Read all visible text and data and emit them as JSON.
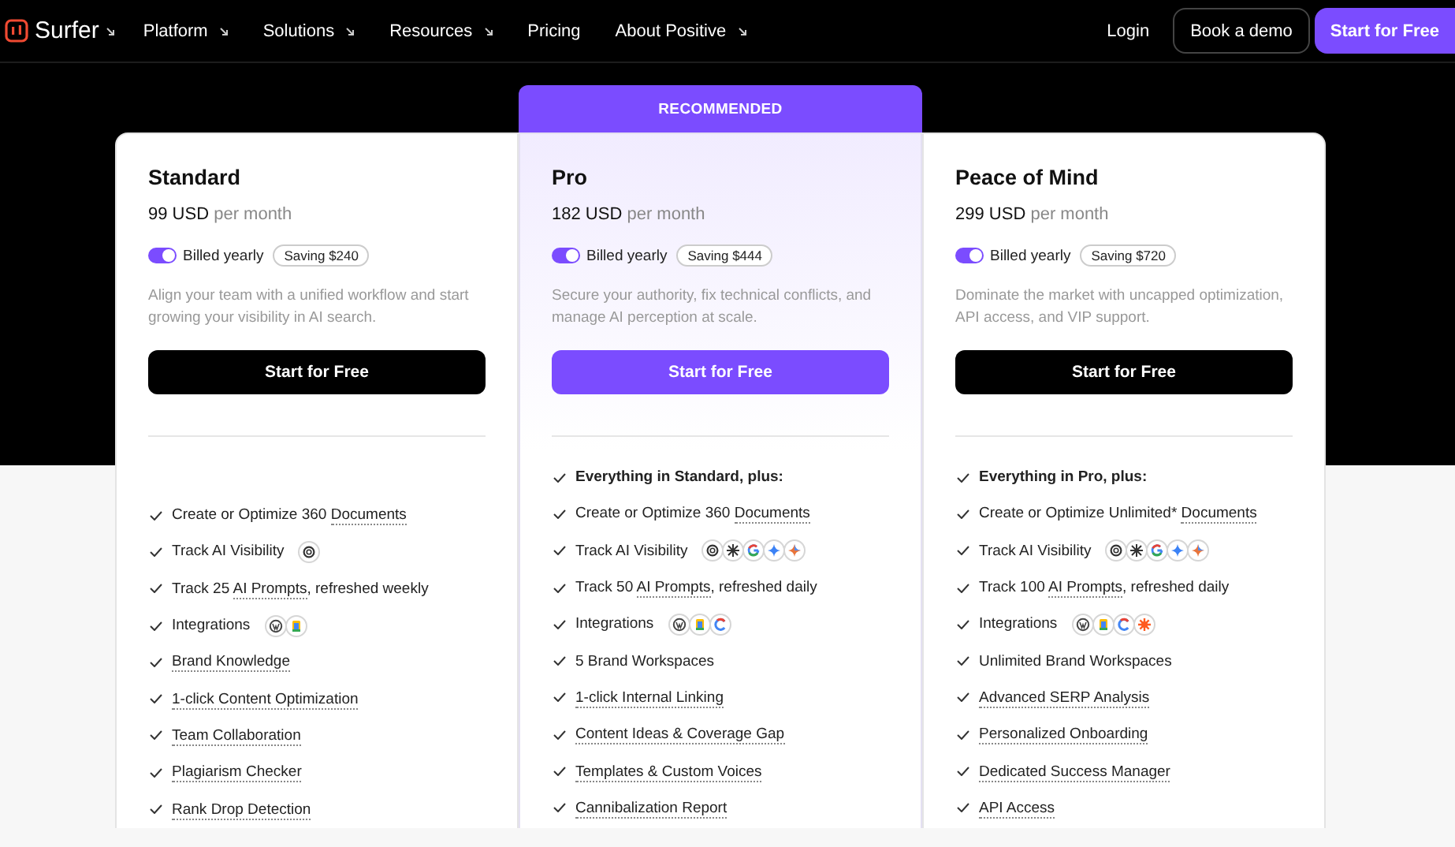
{
  "nav": {
    "brand": "Surfer",
    "brand_menu": true,
    "items": [
      {
        "label": "Platform",
        "has_menu": true
      },
      {
        "label": "Solutions",
        "has_menu": true
      },
      {
        "label": "Resources",
        "has_menu": true
      },
      {
        "label": "Pricing",
        "has_menu": false
      },
      {
        "label": "About Positive",
        "has_menu": true
      }
    ],
    "login": "Login",
    "demo_button": "Book a demo",
    "cta_button": "Start for Free"
  },
  "plans": [
    {
      "name": "Standard",
      "recommended": false,
      "price": "99 USD",
      "period": "per month",
      "billing": {
        "label": "Billed yearly",
        "on": true
      },
      "saving": "Saving $240",
      "description": "Align your team with a unified workflow and start growing your visibility in AI search.",
      "button": "Start for Free",
      "features": [
        {
          "kind": "terms",
          "parts": [
            {
              "text": "Create or Optimize 360 ",
              "dotted": false
            },
            {
              "text": "Documents",
              "dotted": true
            }
          ]
        },
        {
          "kind": "icons",
          "parts": [
            {
              "text": "Track AI Visibility",
              "dotted": false
            }
          ],
          "icons": [
            {
              "kind": "knot"
            }
          ]
        },
        {
          "kind": "terms",
          "parts": [
            {
              "text": "Track 25 ",
              "dotted": false
            },
            {
              "text": "AI Prompts",
              "dotted": true
            },
            {
              "text": ", refreshed weekly",
              "dotted": false
            }
          ]
        },
        {
          "kind": "icons",
          "parts": [
            {
              "text": "Integrations",
              "dotted": false
            }
          ],
          "icons": [
            {
              "kind": "wordpress"
            },
            {
              "kind": "docs"
            }
          ]
        },
        {
          "kind": "terms",
          "parts": [
            {
              "text": "Brand Knowledge",
              "dotted": true
            }
          ]
        },
        {
          "kind": "terms",
          "parts": [
            {
              "text": "1-click Content Optimization",
              "dotted": true
            }
          ]
        },
        {
          "kind": "terms",
          "parts": [
            {
              "text": "Team Collaboration",
              "dotted": true
            }
          ]
        },
        {
          "kind": "terms",
          "parts": [
            {
              "text": "Plagiarism Checker",
              "dotted": true
            }
          ]
        },
        {
          "kind": "terms",
          "parts": [
            {
              "text": "Rank Drop Detection",
              "dotted": true
            }
          ]
        }
      ]
    },
    {
      "name": "Pro",
      "recommended": true,
      "ribbon": "RECOMMENDED",
      "price": "182 USD",
      "period": "per month",
      "billing": {
        "label": "Billed yearly",
        "on": true
      },
      "saving": "Saving $444",
      "description": "Secure your authority, fix technical conflicts, and manage AI perception at scale.",
      "button": "Start for Free",
      "features": [
        {
          "kind": "heading",
          "parts": [
            {
              "text": "Everything in Standard, plus:",
              "dotted": false
            }
          ]
        },
        {
          "kind": "terms",
          "parts": [
            {
              "text": "Create or Optimize 360 ",
              "dotted": false
            },
            {
              "text": "Documents",
              "dotted": true
            }
          ]
        },
        {
          "kind": "icons",
          "parts": [
            {
              "text": "Track AI Visibility",
              "dotted": false
            }
          ],
          "icons": [
            {
              "kind": "knot"
            },
            {
              "kind": "burst"
            },
            {
              "kind": "google"
            },
            {
              "kind": "star"
            },
            {
              "kind": "spark"
            }
          ]
        },
        {
          "kind": "terms",
          "parts": [
            {
              "text": "Track 50 ",
              "dotted": false
            },
            {
              "text": "AI Prompts",
              "dotted": true
            },
            {
              "text": ", refreshed daily",
              "dotted": false
            }
          ]
        },
        {
          "kind": "icons",
          "parts": [
            {
              "text": "Integrations",
              "dotted": false
            }
          ],
          "icons": [
            {
              "kind": "wordpress"
            },
            {
              "kind": "docs"
            },
            {
              "kind": "ring"
            }
          ]
        },
        {
          "kind": "terms",
          "parts": [
            {
              "text": "5 Brand Workspaces",
              "dotted": false
            }
          ]
        },
        {
          "kind": "terms",
          "parts": [
            {
              "text": "1-click Internal Linking",
              "dotted": true
            }
          ]
        },
        {
          "kind": "terms",
          "parts": [
            {
              "text": "Content Ideas & Coverage Gap",
              "dotted": true
            }
          ]
        },
        {
          "kind": "terms",
          "parts": [
            {
              "text": "Templates & Custom Voices",
              "dotted": true
            }
          ]
        },
        {
          "kind": "terms",
          "parts": [
            {
              "text": "Cannibalization Report",
              "dotted": true
            }
          ]
        }
      ]
    },
    {
      "name": "Peace of Mind",
      "recommended": false,
      "price": "299 USD",
      "period": "per month",
      "billing": {
        "label": "Billed yearly",
        "on": true
      },
      "saving": "Saving $720",
      "description": "Dominate the market with uncapped optimization, API access, and VIP support.",
      "button": "Start for Free",
      "features": [
        {
          "kind": "heading",
          "parts": [
            {
              "text": "Everything in Pro, plus:",
              "dotted": false
            }
          ]
        },
        {
          "kind": "terms",
          "parts": [
            {
              "text": "Create or Optimize Unlimited* ",
              "dotted": false
            },
            {
              "text": "Documents",
              "dotted": true
            }
          ]
        },
        {
          "kind": "icons",
          "parts": [
            {
              "text": "Track AI Visibility",
              "dotted": false
            }
          ],
          "icons": [
            {
              "kind": "knot"
            },
            {
              "kind": "burst"
            },
            {
              "kind": "google"
            },
            {
              "kind": "star"
            },
            {
              "kind": "spark"
            }
          ]
        },
        {
          "kind": "terms",
          "parts": [
            {
              "text": "Track 100 ",
              "dotted": false
            },
            {
              "text": "AI Prompts",
              "dotted": true
            },
            {
              "text": ", refreshed daily",
              "dotted": false
            }
          ]
        },
        {
          "kind": "icons",
          "parts": [
            {
              "text": "Integrations",
              "dotted": false
            }
          ],
          "icons": [
            {
              "kind": "wordpress"
            },
            {
              "kind": "docs"
            },
            {
              "kind": "ring"
            },
            {
              "kind": "cog"
            }
          ]
        },
        {
          "kind": "terms",
          "parts": [
            {
              "text": "Unlimited Brand Workspaces",
              "dotted": false
            }
          ]
        },
        {
          "kind": "terms",
          "parts": [
            {
              "text": "Advanced SERP Analysis",
              "dotted": true
            }
          ]
        },
        {
          "kind": "terms",
          "parts": [
            {
              "text": "Personalized Onboarding",
              "dotted": true
            }
          ]
        },
        {
          "kind": "terms",
          "parts": [
            {
              "text": "Dedicated Success Manager",
              "dotted": true
            }
          ]
        },
        {
          "kind": "terms",
          "parts": [
            {
              "text": "API Access",
              "dotted": true
            }
          ]
        }
      ]
    }
  ]
}
